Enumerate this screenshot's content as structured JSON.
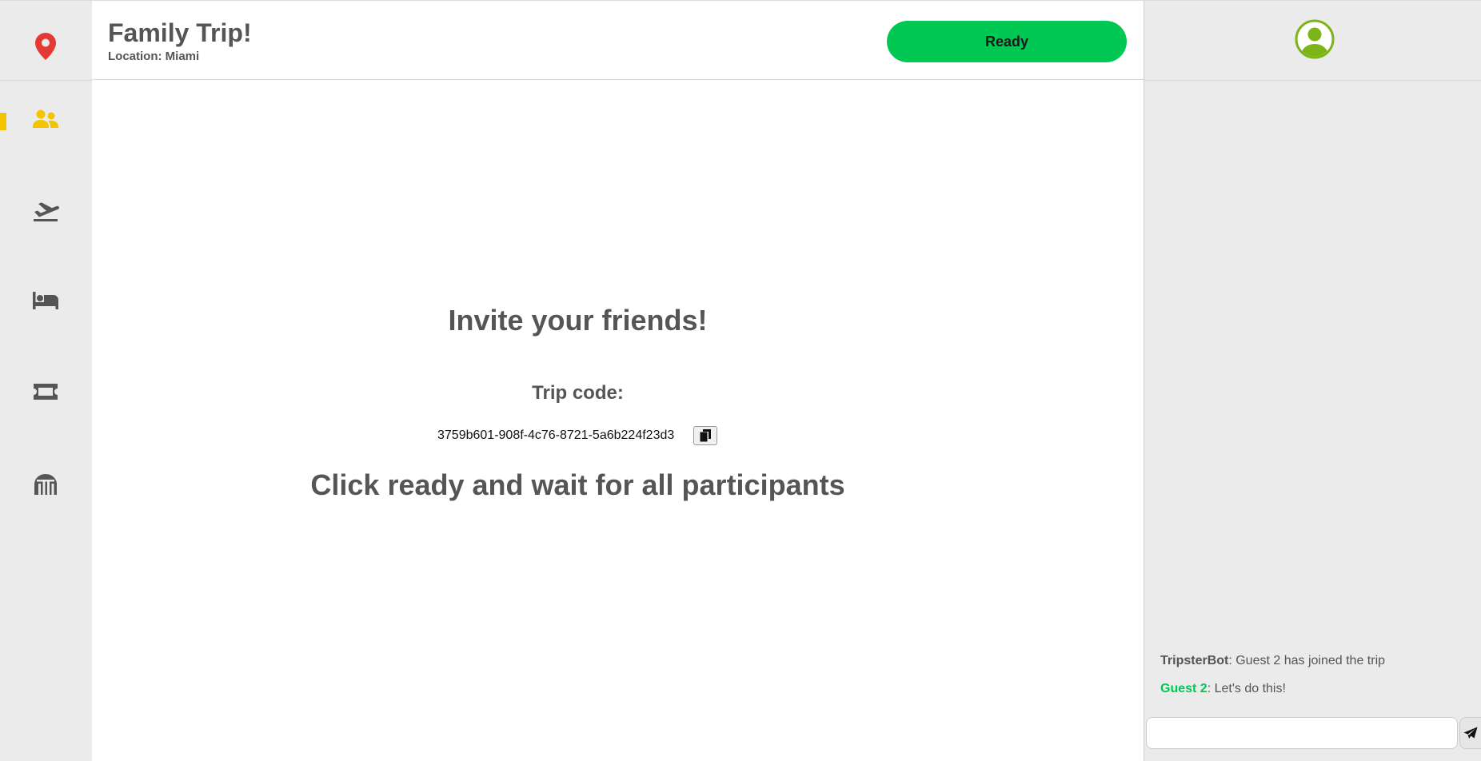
{
  "app": {
    "accent_color": "#f5c400",
    "ready_color": "#00c853"
  },
  "sidebar": {
    "logo_icon": "map-pin-icon",
    "items": [
      {
        "name": "participants",
        "icon": "users-icon",
        "active": true
      },
      {
        "name": "flights",
        "icon": "plane-departure-icon",
        "active": false
      },
      {
        "name": "hotels",
        "icon": "bed-icon",
        "active": false
      },
      {
        "name": "tickets",
        "icon": "ticket-icon",
        "active": false
      },
      {
        "name": "attractions",
        "icon": "landmark-icon",
        "active": false
      }
    ]
  },
  "header": {
    "title": "Family Trip!",
    "location": "Location: Miami",
    "ready_label": "Ready"
  },
  "main": {
    "invite_title": "Invite your friends!",
    "code_label": "Trip code:",
    "trip_code": "3759b601-908f-4c76-8721-5a6b224f23d3",
    "wait_text": "Click ready and wait for all participants"
  },
  "chat": {
    "avatar_icon": "user-avatar-icon",
    "messages": [
      {
        "sender": "TripsterBot",
        "separator": ": ",
        "text": "Guest 2 has joined the trip"
      },
      {
        "sender": "Guest 2",
        "separator": ": ",
        "text": "Let's do this!"
      }
    ],
    "input_value": "",
    "send_icon": "send-icon"
  }
}
